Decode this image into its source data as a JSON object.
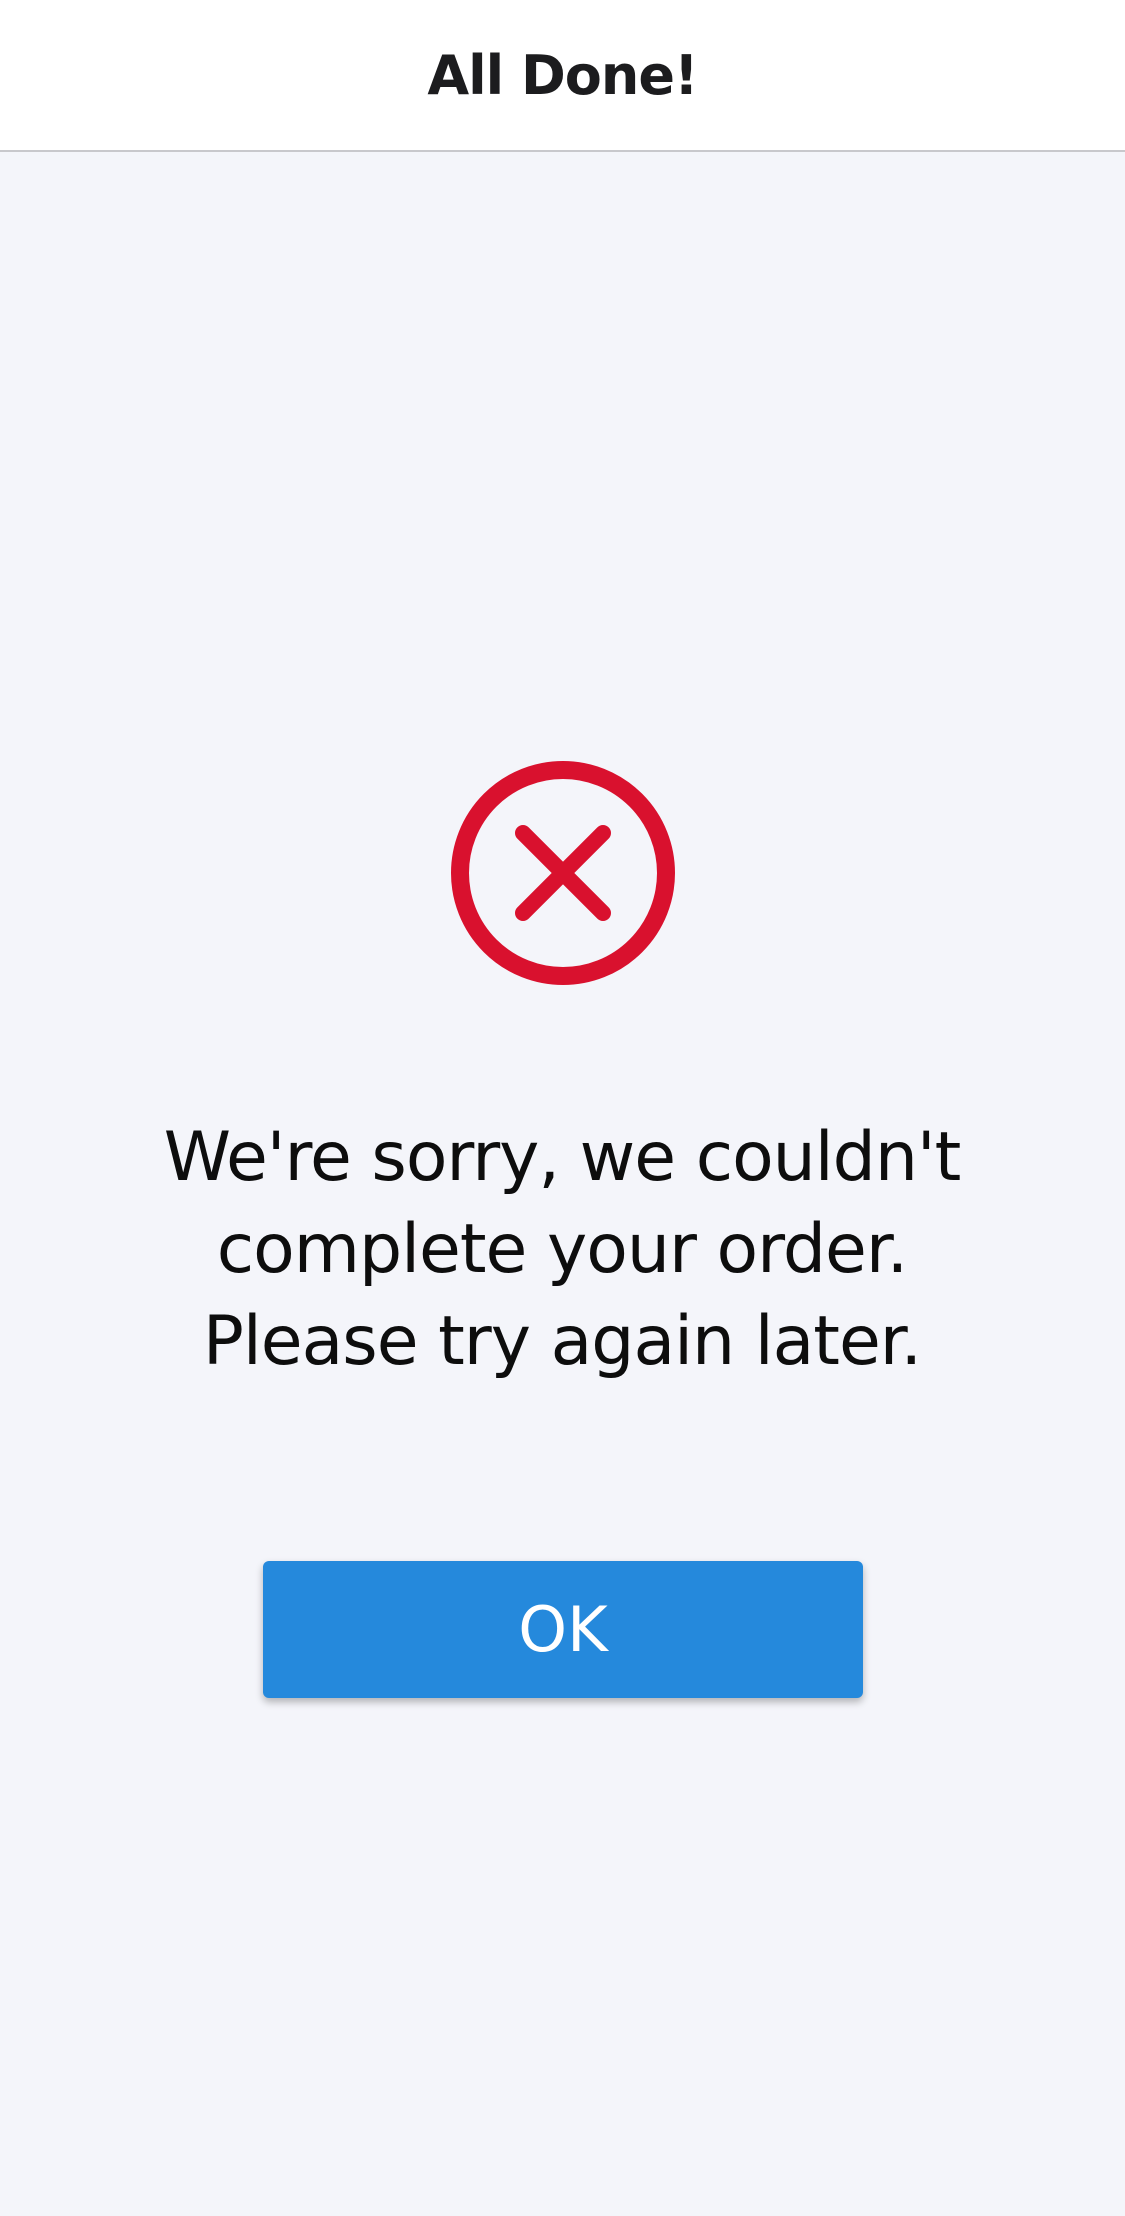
{
  "header": {
    "title": "All Done!"
  },
  "status": {
    "icon": "error-x-circle-icon",
    "color": "#d9112e"
  },
  "message": {
    "lines": [
      "We're sorry, we couldn't",
      "complete your order.",
      "Please try again later."
    ]
  },
  "actions": {
    "ok_label": "OK",
    "ok_color": "#2589dc"
  }
}
